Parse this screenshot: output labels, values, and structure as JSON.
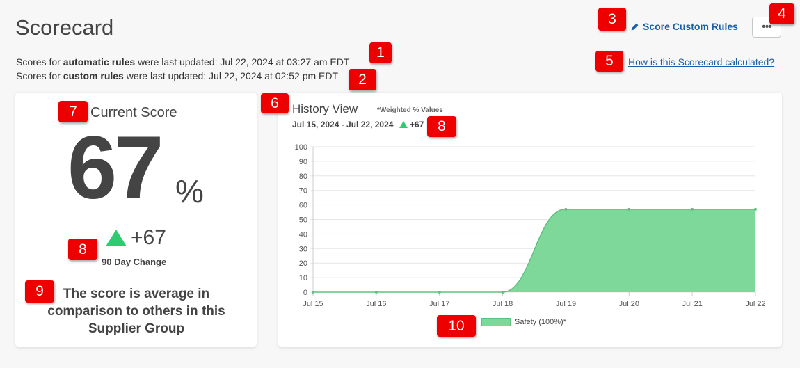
{
  "page": {
    "title": "Scorecard",
    "auto_update": {
      "prefix": "Scores for ",
      "bold": "automatic rules",
      "suffix": " were last updated: Jul 22, 2024 at 03:27 am EDT"
    },
    "custom_update": {
      "prefix": "Scores for ",
      "bold": "custom rules",
      "suffix": " were last updated: Jul 22, 2024 at 02:52 pm EDT"
    },
    "score_rules_label": "Score Custom Rules",
    "more_label": "•••",
    "help_link": "How is this Scorecard calculated?"
  },
  "current_score": {
    "title": "Current Score",
    "value": "67",
    "unit": "%",
    "change": "+67",
    "change_label": "90 Day Change",
    "comparison_prefix": "The score is ",
    "comparison_bold": "average",
    "comparison_suffix": " in comparison to others in this Supplier Group"
  },
  "history": {
    "title": "History View",
    "subtitle": "*Weighted % Values",
    "date_range": "Jul 15, 2024 - Jul 22, 2024",
    "change": "+67"
  },
  "badges": [
    "1",
    "2",
    "3",
    "4",
    "5",
    "6",
    "7",
    "8",
    "8",
    "9",
    "10"
  ],
  "colors": {
    "positive": "#2ecc71",
    "area_fill": "#7dd89a",
    "area_stroke": "#5ec27e",
    "link": "#1a5fa8",
    "badge": "#ee0000"
  },
  "chart_data": {
    "type": "area",
    "categories": [
      "Jul 15",
      "Jul 16",
      "Jul 17",
      "Jul 18",
      "Jul 19",
      "Jul 20",
      "Jul 21",
      "Jul 22"
    ],
    "series": [
      {
        "name": "Safety (100%)*",
        "values": [
          0,
          0,
          0,
          0,
          57,
          57,
          57,
          57
        ]
      }
    ],
    "ylim": [
      0,
      100
    ],
    "yticks": [
      "0",
      "10",
      "20",
      "30",
      "40",
      "50",
      "60",
      "70",
      "80",
      "90",
      "100"
    ],
    "grid": true,
    "legend": "bottom"
  }
}
